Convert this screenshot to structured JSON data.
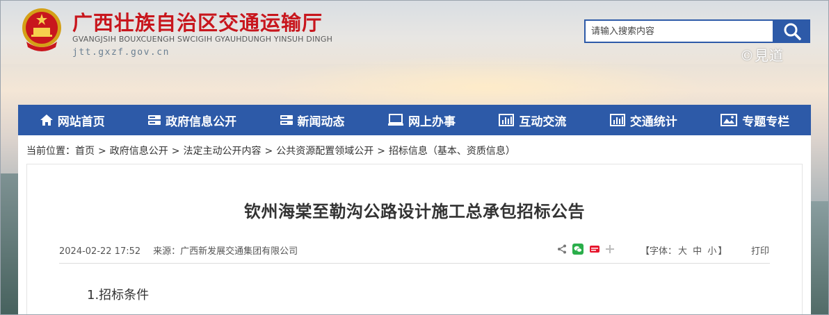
{
  "header": {
    "title": "广西壮族自治区交通运输厅",
    "subtitle": "GVANGJSIH BOUXCUENGH SWCIGIH GYAUHDUNGH YINSUH DINGH",
    "url": "jtt.gxzf.gov.cn",
    "search_placeholder": "请输入搜索内容",
    "watermark": "©見道"
  },
  "nav": {
    "items": [
      {
        "label": "网站首页",
        "icon": "home-icon"
      },
      {
        "label": "政府信息公开",
        "icon": "server-icon"
      },
      {
        "label": "新闻动态",
        "icon": "server-icon"
      },
      {
        "label": "网上办事",
        "icon": "monitor-icon"
      },
      {
        "label": "互动交流",
        "icon": "bar-chart-icon"
      },
      {
        "label": "交通统计",
        "icon": "bar-chart-icon"
      },
      {
        "label": "专题专栏",
        "icon": "image-icon"
      }
    ]
  },
  "breadcrumb": {
    "prefix": "当前位置：",
    "items": [
      "首页",
      "政府信息公开",
      "法定主动公开内容",
      "公共资源配置领域公开",
      "招标信息（基本、资质信息）"
    ],
    "separator": ">"
  },
  "article": {
    "title": "钦州海棠至勒沟公路设计施工总承包招标公告",
    "date": "2024-02-22 17:52",
    "source": "来源：广西新发展交通集团有限公司",
    "fontsize_prefix": "【字体：",
    "fontsize_options": [
      "大",
      "中",
      "小"
    ],
    "fontsize_suffix": "】",
    "print_label": "打印",
    "section_heading": "1.招标条件"
  },
  "colors": {
    "brand_red": "#c8161d",
    "nav_blue": "#2d5aa8"
  }
}
